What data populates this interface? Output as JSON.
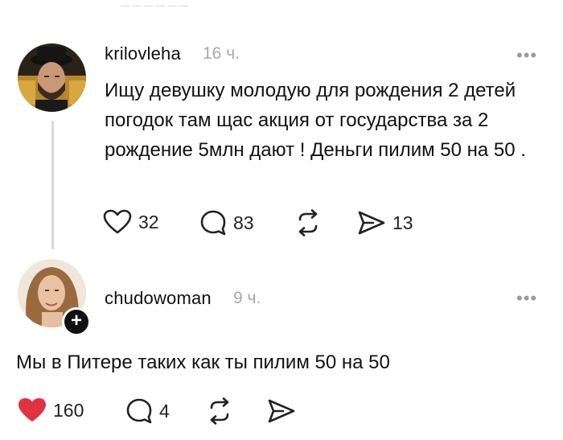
{
  "post": {
    "username": "krilovleha",
    "time": "16 ч.",
    "more": "•••",
    "text": "Ищу девушку молодую для рождения 2 детей погодок там щас акция от государства за 2 рождение 5млн дают !  Деньги пилим 50 на 50 .",
    "likes": "32",
    "comments": "83",
    "shares": "13"
  },
  "reply": {
    "username": "chudowoman",
    "time": "9 ч.",
    "more": "•••",
    "text": "Мы в Питере таких как ты пилим 50 на 50",
    "likes": "160",
    "comments": "4",
    "follow_badge": "+"
  },
  "colors": {
    "liked_heart": "#e0323f",
    "text": "#111111",
    "muted": "#a8a8a8",
    "thread_line": "#d9d9d9"
  },
  "icons": [
    "heart-icon",
    "comment-bubble-icon",
    "repost-icon",
    "send-icon",
    "more-icon",
    "plus-icon"
  ]
}
